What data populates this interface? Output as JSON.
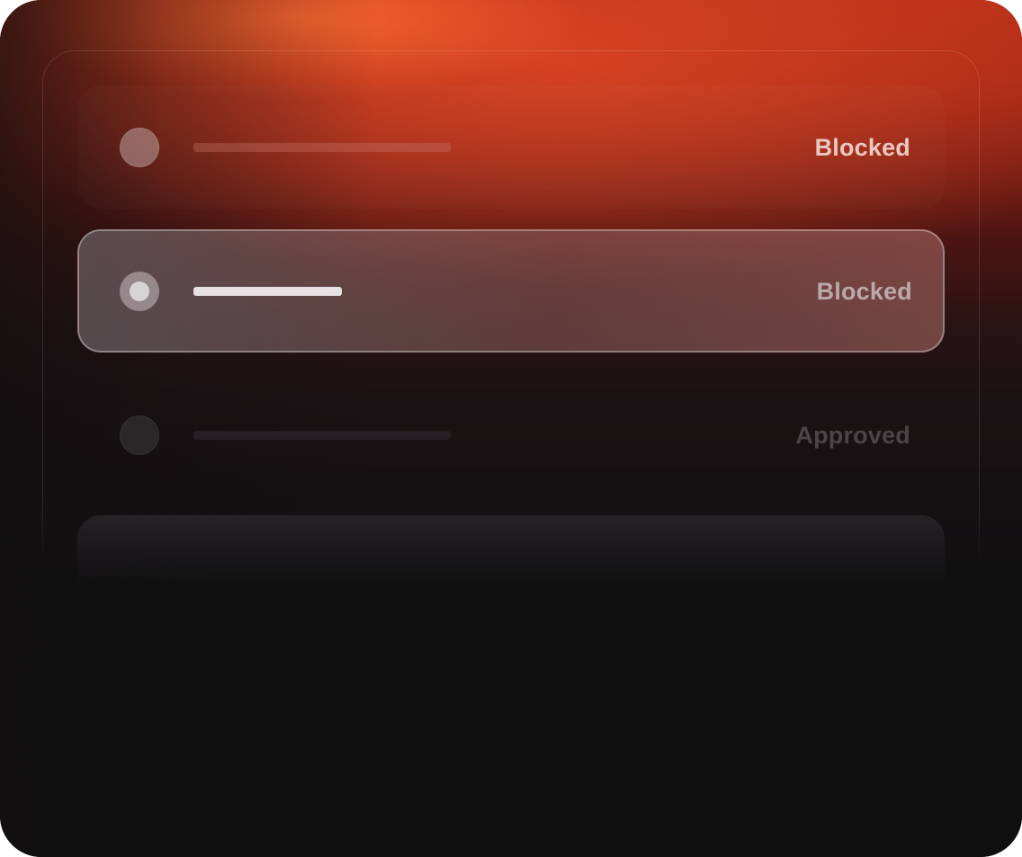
{
  "rows": [
    {
      "status": "Blocked",
      "state": "faded"
    },
    {
      "status": "Blocked",
      "state": "selected"
    },
    {
      "status": "Approved",
      "state": "faded"
    }
  ],
  "colors": {
    "accent": "#c9361b",
    "background": "#110f10",
    "selected_text": "#b9a9ab"
  }
}
